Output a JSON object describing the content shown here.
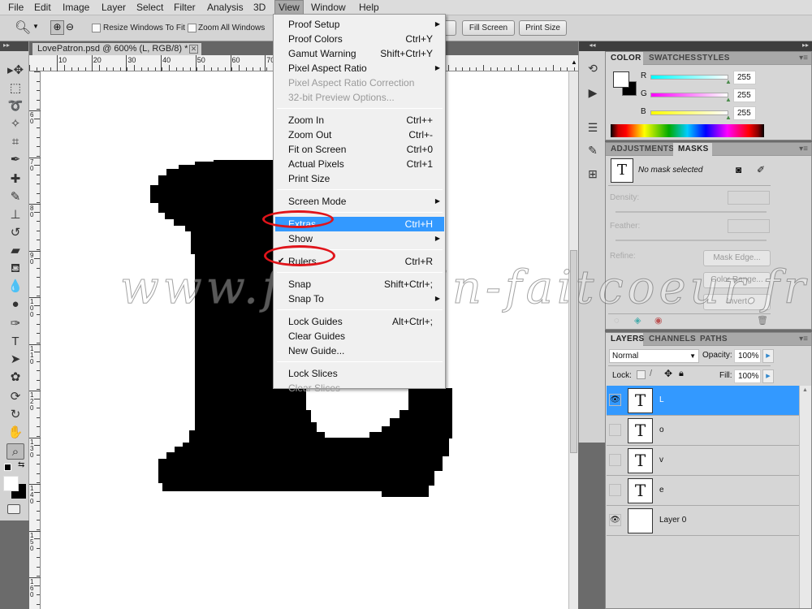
{
  "menubar": {
    "items": [
      "File",
      "Edit",
      "Image",
      "Layer",
      "Select",
      "Filter",
      "Analysis",
      "3D",
      "View",
      "Window",
      "Help"
    ],
    "active": "View"
  },
  "options": {
    "tool_icon": "zoom-icon",
    "resize_windows": {
      "label": "Resize Windows To Fit",
      "checked": false
    },
    "zoom_all": {
      "label": "Zoom All Windows",
      "checked": false
    },
    "fill_screen": "Fill Screen",
    "print_size": "Print Size"
  },
  "document": {
    "tab_title": "LovePatron.psd @ 600% (L, RGB/8) *",
    "close": "✕"
  },
  "rulers": {
    "top": [
      "10",
      "20",
      "30",
      "40",
      "50",
      "60",
      "70",
      "80",
      "90",
      "100",
      "110"
    ],
    "left": [
      "6 0",
      "7 0",
      "8 0",
      "9 0",
      "1 0 0",
      "1 1 0",
      "1 2 0",
      "1 3 0",
      "1 4 0",
      "1 5 0",
      "1 6 0"
    ]
  },
  "view_menu": {
    "items": [
      {
        "label": "Proof Setup",
        "submenu": true
      },
      {
        "label": "Proof Colors",
        "shortcut": "Ctrl+Y"
      },
      {
        "label": "Gamut Warning",
        "shortcut": "Shift+Ctrl+Y"
      },
      {
        "label": "Pixel Aspect Ratio",
        "submenu": true
      },
      {
        "label": "Pixel Aspect Ratio Correction",
        "disabled": true
      },
      {
        "label": "32-bit Preview Options...",
        "disabled": true
      },
      {
        "sep": true
      },
      {
        "label": "Zoom In",
        "shortcut": "Ctrl++"
      },
      {
        "label": "Zoom Out",
        "shortcut": "Ctrl+-"
      },
      {
        "label": "Fit on Screen",
        "shortcut": "Ctrl+0"
      },
      {
        "label": "Actual Pixels",
        "shortcut": "Ctrl+1"
      },
      {
        "label": "Print Size"
      },
      {
        "sep": true
      },
      {
        "label": "Screen Mode",
        "submenu": true
      },
      {
        "sep": true
      },
      {
        "label": "Extras",
        "shortcut": "Ctrl+H",
        "highlighted": true
      },
      {
        "label": "Show",
        "submenu": true
      },
      {
        "sep": true
      },
      {
        "label": "Rulers",
        "shortcut": "Ctrl+R",
        "checked": true
      },
      {
        "sep": true
      },
      {
        "label": "Snap",
        "shortcut": "Shift+Ctrl+;"
      },
      {
        "label": "Snap To",
        "submenu": true
      },
      {
        "sep": true
      },
      {
        "label": "Lock Guides",
        "shortcut": "Alt+Ctrl+;"
      },
      {
        "label": "Clear Guides"
      },
      {
        "label": "New Guide..."
      },
      {
        "sep": true
      },
      {
        "label": "Lock Slices"
      },
      {
        "label": "Clear Slices",
        "disabled": true
      }
    ],
    "check_glyph": "✔",
    "annotation_color": "#e0141a",
    "highlight_color": "#3399ff"
  },
  "watermark": "www.faitmain-faitcoeur.fr",
  "color_panel": {
    "tabs": [
      "COLOR",
      "SWATCHES",
      "STYLES"
    ],
    "active": "COLOR",
    "channels": [
      {
        "label": "R",
        "value": "255"
      },
      {
        "label": "G",
        "value": "255"
      },
      {
        "label": "B",
        "value": "255"
      }
    ],
    "foreground": "#ffffff",
    "background": "#000000"
  },
  "masks_panel": {
    "tabs": [
      "ADJUSTMENTS",
      "MASKS"
    ],
    "active": "MASKS",
    "status": "No mask selected",
    "density_label": "Density:",
    "feather_label": "Feather:",
    "refine_label": "Refine:",
    "buttons": [
      "Mask Edge...",
      "Color Range...",
      "Invert"
    ]
  },
  "layers_panel": {
    "tabs": [
      "LAYERS",
      "CHANNELS",
      "PATHS"
    ],
    "active": "LAYERS",
    "blend_mode": "Normal",
    "opacity_label": "Opacity:",
    "opacity": "100%",
    "lock_label": "Lock:",
    "fill_label": "Fill:",
    "fill": "100%",
    "layers": [
      {
        "name": "L",
        "type": "text",
        "visible": true,
        "selected": true
      },
      {
        "name": "o",
        "type": "text",
        "visible": false
      },
      {
        "name": "v",
        "type": "text",
        "visible": false
      },
      {
        "name": "e",
        "type": "text",
        "visible": false
      },
      {
        "name": "Layer 0",
        "type": "pixel",
        "visible": true
      }
    ],
    "text_thumb": "T"
  }
}
